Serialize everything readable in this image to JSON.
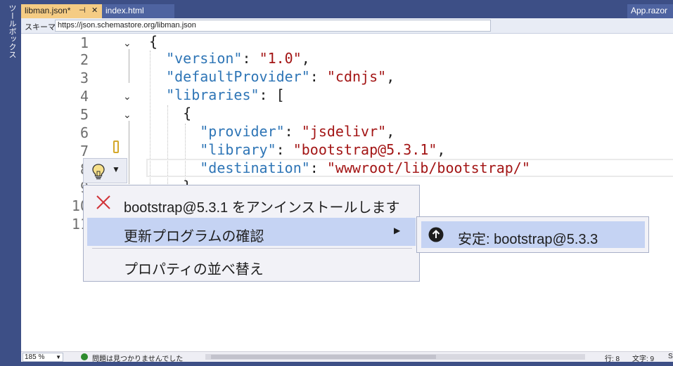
{
  "toolbox": {
    "label": "ツールボックス"
  },
  "tabs": {
    "active": {
      "label": "libman.json*",
      "pin": "⊣",
      "close": "✕"
    },
    "inactive": {
      "label": "index.html"
    },
    "right": {
      "label": "App.razor"
    }
  },
  "schema": {
    "label": "スキーマ:",
    "url": "https://json.schemastore.org/libman.json"
  },
  "editor": {
    "line_numbers": [
      "1",
      "2",
      "3",
      "4",
      "5",
      "6",
      "7",
      "8",
      "9",
      "10",
      "11"
    ],
    "code": {
      "l1_brace": "{",
      "l2_key": "\"version\"",
      "l2_val": "\"1.0\"",
      "l3_key": "\"defaultProvider\"",
      "l3_val": "\"cdnjs\"",
      "l4_key": "\"libraries\"",
      "l4_open": ": [",
      "l5_brace": "{",
      "l6_key": "\"provider\"",
      "l6_val": "\"jsdelivr\"",
      "l7_key": "\"library\"",
      "l7_val": "\"bootstrap@5.3.1\"",
      "l8_key": "\"destination\"",
      "l8_val": "\"wwwroot/lib/bootstrap/\"",
      "colon": ": ",
      "comma": ",",
      "l9_brace": "}"
    }
  },
  "quick_actions": {
    "items": [
      {
        "label": "bootstrap@5.3.1 をアンインストールします",
        "icon": "x-icon"
      },
      {
        "label": "更新プログラムの確認",
        "icon": "none"
      },
      {
        "label": "プロパティの並べ替え",
        "icon": "none"
      }
    ],
    "submenu": {
      "label": "安定: bootstrap@5.3.3",
      "icon": "up-arrow-circle-icon"
    }
  },
  "status": {
    "zoom": "185 %",
    "message": "問題は見つかりませんでした",
    "line": "行: 8",
    "col": "文字: 9",
    "extra": "S"
  },
  "colors": {
    "chrome": "#3d4f86",
    "active_tab": "#f5cc84",
    "json_key": "#2e75b6",
    "json_string": "#a31515",
    "menu_highlight": "#c5d3f3"
  }
}
